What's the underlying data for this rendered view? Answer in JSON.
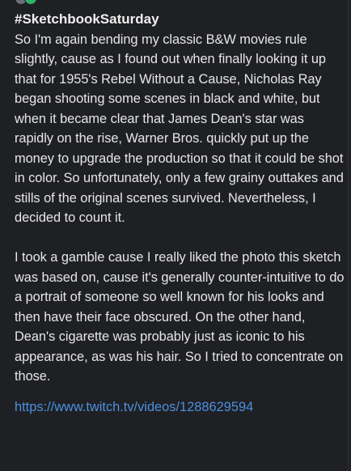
{
  "post": {
    "hashtag": "#SketchbookSaturday",
    "paragraph_1": "So I'm again bending my classic B&W movies rule slightly, cause as I found out when finally looking it up that for 1955's Rebel Without a Cause, Nicholas Ray began shooting some scenes in black and white, but when it became clear that James Dean's star was rapidly on the rise, Warner Bros. quickly put up the money to upgrade the production so that it could be shot in color. So unfortunately, only a few grainy outtakes and stills of the original scenes survived. Nevertheless, I decided to count it.",
    "paragraph_2": "I took a gamble cause I really liked the photo this sketch was based on, cause it's generally counter-intuitive to do a portrait of someone so well known for his looks and then have their face obscured. On the other hand, Dean's cigarette was probably just as iconic to his appearance, as was his hair. So I tried to concentrate on those.",
    "link_text": "https://www.twitch.tv/videos/1288629594",
    "link_href": "https://www.twitch.tv/videos/1288629594"
  },
  "colors": {
    "background": "#1f2023",
    "text": "#e6e6e6",
    "link": "#4a90e2"
  }
}
